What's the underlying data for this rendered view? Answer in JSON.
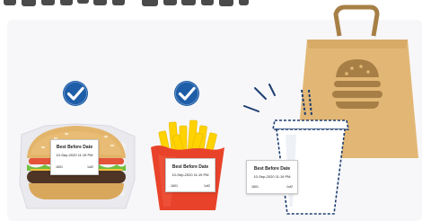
{
  "colors": {
    "panel_background": "#f7f7f9",
    "title_text": "#4a4a4a",
    "check_badge": "#1e5da8",
    "bun": "#e3b56b",
    "patty": "#4d3424",
    "lettuce": "#6fbf3f",
    "fries": "#ffd200",
    "fries_box": "#e8432a",
    "bag": "#e2b775",
    "bag_handle": "#a77f46",
    "cup_outline": "#1d3d70",
    "label_border": "#c8c8c8"
  },
  "icons": {
    "burger_check": "checkmark-circle-icon",
    "fries_check": "checkmark-circle-icon",
    "bag_emblem": "burger-icon"
  },
  "labels": {
    "burger": {
      "title": "Best Before Date",
      "date": "10-Sep-2020 11:19 PM",
      "code": "1601",
      "count": "1of2"
    },
    "fries": {
      "title": "Best Before Date",
      "date": "10-Sep-2020 11:19 PM",
      "code": "1601",
      "count": "1of2"
    },
    "cup": {
      "title": "Best Before Date",
      "date": "10-Sep-2020 11:19 PM",
      "code": "1601",
      "count": "1of2"
    }
  }
}
